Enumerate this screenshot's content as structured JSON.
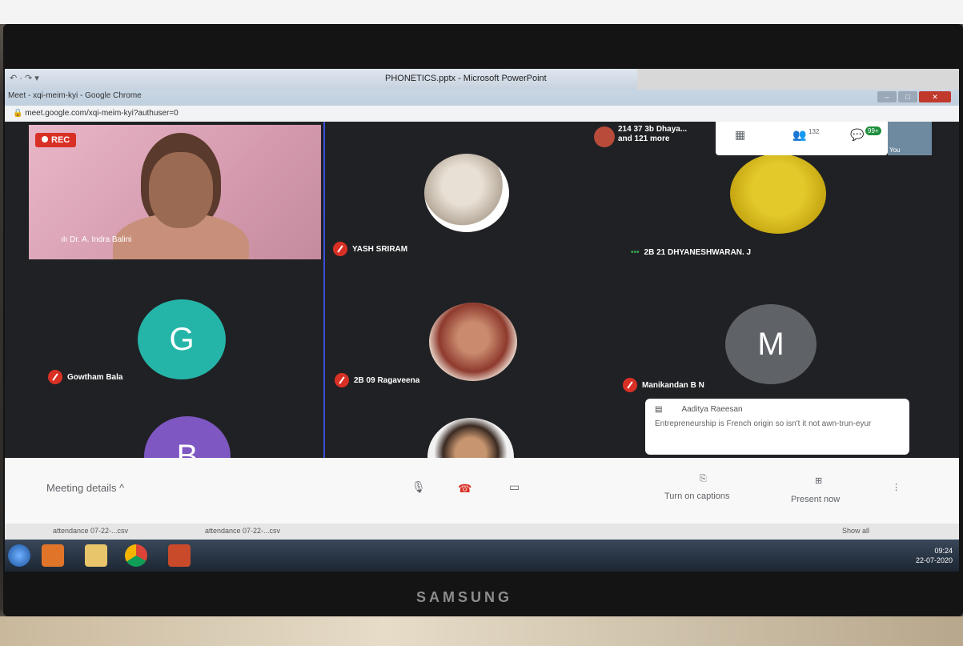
{
  "powerpoint": {
    "title": "PHONETICS.pptx - Microsoft PowerPoint"
  },
  "chrome": {
    "tab_title": "Meet - xqi-meim-kyi - Google Chrome",
    "url": "meet.google.com/xqi-meim-kyi?authuser=0"
  },
  "meet": {
    "rec_label": "REC",
    "host_name": "Dr. A. Indra Balini",
    "participants_summary_line1": "214 37 3b Dhaya...",
    "participants_summary_line2": "and 121 more",
    "people_count": "132",
    "chat_badge": "99+",
    "you_label": "You",
    "tiles": [
      {
        "name": "YASH SRIRAM"
      },
      {
        "name": "2B 21 DHYANESHWARAN. J"
      },
      {
        "name": "Gowtham Bala",
        "initial": "G",
        "color": "#25b5a8"
      },
      {
        "name": "2B 09 Ragaveena"
      },
      {
        "name": "Manikandan B N",
        "initial": "M",
        "color": "#5f6368"
      },
      {
        "initial": "B",
        "color": "#7e57c2"
      }
    ],
    "chat_popup": {
      "author": "Aaditya Raeesan",
      "message": "Entrepreneurship is French origin so isn't it not awn-trun-eyur"
    }
  },
  "bottom_bar": {
    "meeting_details": "Meeting details",
    "captions": "Turn on captions",
    "present": "Present now"
  },
  "downloads": {
    "item1": "attendance 07-22-...csv",
    "item2": "attendance 07-22-...csv",
    "show_all": "Show all"
  },
  "taskbar": {
    "time": "09:24",
    "date": "22-07-2020"
  },
  "monitor_brand": "SAMSUNG"
}
